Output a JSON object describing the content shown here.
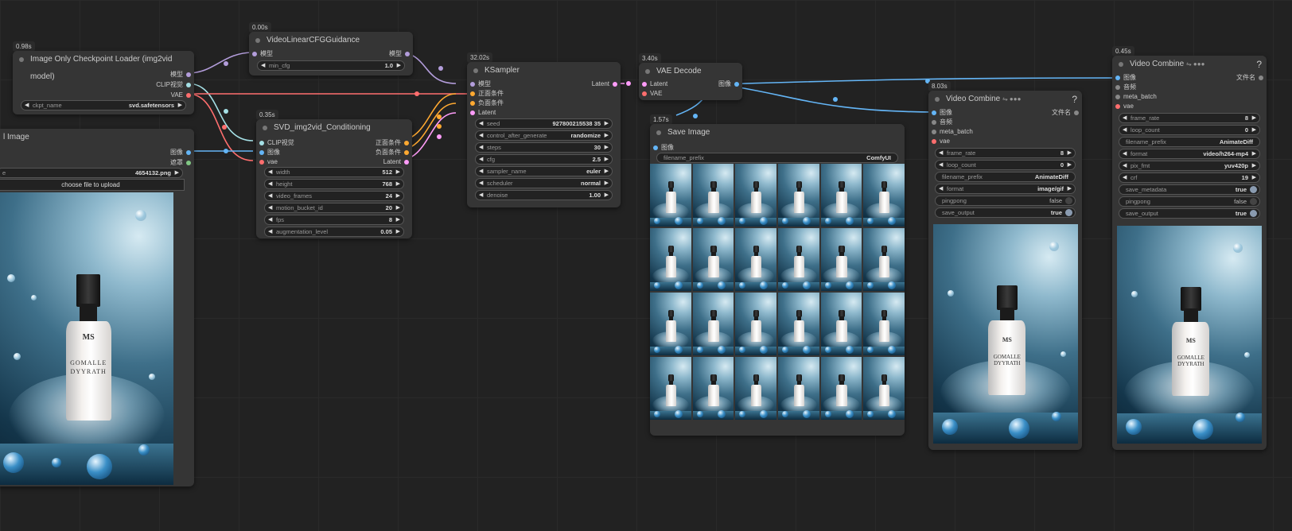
{
  "colors": {
    "model": "#b39ddb",
    "clip": "#ffd54f",
    "vae": "#ff6e6e",
    "image": "#64b5f6",
    "mask": "#81c784",
    "latent": "#ff9cf9",
    "cond": "#ffa931"
  },
  "nodes": {
    "ckpt": {
      "time": "0.98s",
      "title": "Image Only Checkpoint Loader (img2vid model)",
      "outputs": [
        "模型",
        "CLIP视觉",
        "VAE"
      ],
      "widget": {
        "label": "ckpt_name",
        "value": "svd.safetensors"
      }
    },
    "cfg": {
      "time": "0.00s",
      "title": "VideoLinearCFGGuidance",
      "input": "模型",
      "output": "模型",
      "widget": {
        "label": "min_cfg",
        "value": "1.0"
      }
    },
    "load": {
      "title": "l Image",
      "outputs": [
        "图像",
        "遮罩"
      ],
      "image_value": "4654132.png",
      "image_label_partial": "e",
      "upload_label": "choose file to upload"
    },
    "svd": {
      "time": "0.35s",
      "title": "SVD_img2vid_Conditioning",
      "inputs": [
        "CLIP视觉",
        "图像",
        "vae"
      ],
      "outputs": [
        "正面条件",
        "负面条件",
        "Latent"
      ],
      "widgets": [
        {
          "label": "width",
          "value": "512"
        },
        {
          "label": "height",
          "value": "768"
        },
        {
          "label": "video_frames",
          "value": "24"
        },
        {
          "label": "motion_bucket_id",
          "value": "20"
        },
        {
          "label": "fps",
          "value": "8"
        },
        {
          "label": "augmentation_level",
          "value": "0.05"
        }
      ]
    },
    "ksampler": {
      "time": "32.02s",
      "title": "KSampler",
      "inputs": [
        "模型",
        "正面条件",
        "负面条件",
        "Latent"
      ],
      "output": "Latent",
      "widgets": [
        {
          "label": "seed",
          "value": "927800215538 35"
        },
        {
          "label": "control_after_generate",
          "value": "randomize"
        },
        {
          "label": "steps",
          "value": "30"
        },
        {
          "label": "cfg",
          "value": "2.5"
        },
        {
          "label": "sampler_name",
          "value": "euler"
        },
        {
          "label": "scheduler",
          "value": "normal"
        },
        {
          "label": "denoise",
          "value": "1.00"
        }
      ]
    },
    "vaedecode": {
      "time": "3.40s",
      "title": "VAE Decode",
      "inputs": [
        "Latent",
        "VAE"
      ],
      "output": "图像"
    },
    "save": {
      "time": "1.57s",
      "title": "Save Image",
      "input": "图像",
      "widget": {
        "label": "filename_prefix",
        "value": "ComfyUI"
      }
    },
    "combine1": {
      "time": "8.03s",
      "title": "Video Combine",
      "help": "?",
      "inputs": [
        "图像",
        "音频",
        "meta_batch",
        "vae"
      ],
      "output": "文件名",
      "widgets": [
        {
          "label": "frame_rate",
          "value": "8"
        },
        {
          "label": "loop_count",
          "value": "0"
        },
        {
          "label": "filename_prefix",
          "value": "AnimateDiff"
        },
        {
          "label": "format",
          "value": "image/gif"
        }
      ],
      "toggles": [
        {
          "label": "pingpong",
          "value": "false"
        },
        {
          "label": "save_output",
          "value": "true"
        }
      ]
    },
    "combine2": {
      "time": "0.45s",
      "title": "Video Combine",
      "help": "?",
      "inputs": [
        "图像",
        "音频",
        "meta_batch",
        "vae"
      ],
      "output": "文件名",
      "widgets": [
        {
          "label": "frame_rate",
          "value": "8"
        },
        {
          "label": "loop_count",
          "value": "0"
        },
        {
          "label": "filename_prefix",
          "value": "AnimateDiff"
        },
        {
          "label": "format",
          "value": "video/h264-mp4"
        },
        {
          "label": "pix_fmt",
          "value": "yuv420p"
        },
        {
          "label": "crf",
          "value": "19"
        }
      ],
      "toggles": [
        {
          "label": "save_metadata",
          "value": "true"
        },
        {
          "label": "pingpong",
          "value": "false"
        },
        {
          "label": "save_output",
          "value": "true"
        }
      ]
    }
  },
  "product": {
    "brand": "MS",
    "name_line1": "GOMALLE",
    "name_line2": "DYYRATH"
  }
}
